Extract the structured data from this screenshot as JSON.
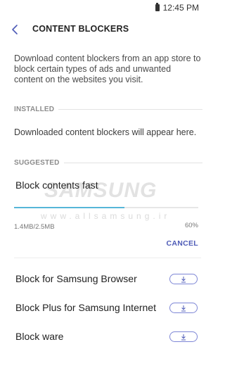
{
  "status_bar": {
    "time": "12:45 PM"
  },
  "app_bar": {
    "title": "CONTENT BLOCKERS"
  },
  "description": "Download content blockers from an app store to block certain types of ads and unwanted content on the websites you visit.",
  "installed": {
    "header": "INSTALLED",
    "empty_text": "Downloaded content blockers will appear here."
  },
  "suggested": {
    "header": "SUGGESTED",
    "downloading": {
      "name": "Block contents fast",
      "size": "1.4MB/2.5MB",
      "percent_label": "60%",
      "progress": 0.6,
      "cancel_label": "CANCEL"
    },
    "items": [
      {
        "name": "Block for Samsung Browser"
      },
      {
        "name": "Block Plus for Samsung Internet"
      },
      {
        "name": "Block ware"
      }
    ]
  },
  "watermark": {
    "logo": "SAMSUNG",
    "url": "www.allsamsung.ir"
  },
  "colors": {
    "accent": "#4e5bb7",
    "progress": "#56b6d8",
    "outline": "#7d86d6"
  },
  "icons": {
    "back": "chevron-left-icon",
    "download": "download-icon",
    "battery": "battery-icon"
  }
}
